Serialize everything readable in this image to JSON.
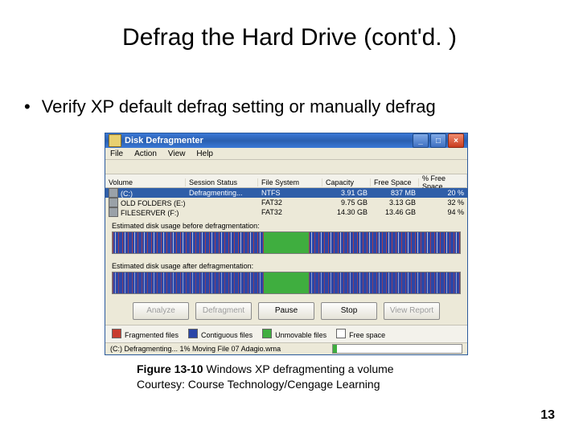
{
  "title": "Defrag the Hard Drive (cont'd. )",
  "bullet": "Verify XP default defrag setting or manually defrag",
  "caption_bold": "Figure 13-10",
  "caption_rest": " Windows XP defragmenting a volume",
  "caption_line2": "Courtesy: Course Technology/Cengage Learning",
  "pagenum": "13",
  "window": {
    "title": "Disk Defragmenter",
    "menu": [
      "File",
      "Action",
      "View",
      "Help"
    ],
    "min": "_",
    "max": "□",
    "close": "×",
    "columns": [
      "Volume",
      "Session Status",
      "File System",
      "Capacity",
      "Free Space",
      "% Free Space"
    ],
    "rows": [
      {
        "vol": "(C:)",
        "status": "Defragmenting...",
        "fs": "NTFS",
        "cap": "3.91 GB",
        "free": "837 MB",
        "pct": "20 %"
      },
      {
        "vol": "OLD FOLDERS (E:)",
        "status": "",
        "fs": "FAT32",
        "cap": "9.75 GB",
        "free": "3.13 GB",
        "pct": "32 %"
      },
      {
        "vol": "FILESERVER (F:)",
        "status": "",
        "fs": "FAT32",
        "cap": "14.30 GB",
        "free": "13.46 GB",
        "pct": "94 %"
      }
    ],
    "label_before": "Estimated disk usage before defragmentation:",
    "label_after": "Estimated disk usage after defragmentation:",
    "buttons": {
      "analyze": "Analyze",
      "defragment": "Defragment",
      "pause": "Pause",
      "stop": "Stop",
      "report": "View Report"
    },
    "legend": {
      "frag": "Fragmented files",
      "contig": "Contiguous files",
      "unmov": "Unmovable files",
      "free": "Free space"
    },
    "status_text": "(C:) Defragmenting... 1% Moving File 07 Adagio.wma"
  }
}
